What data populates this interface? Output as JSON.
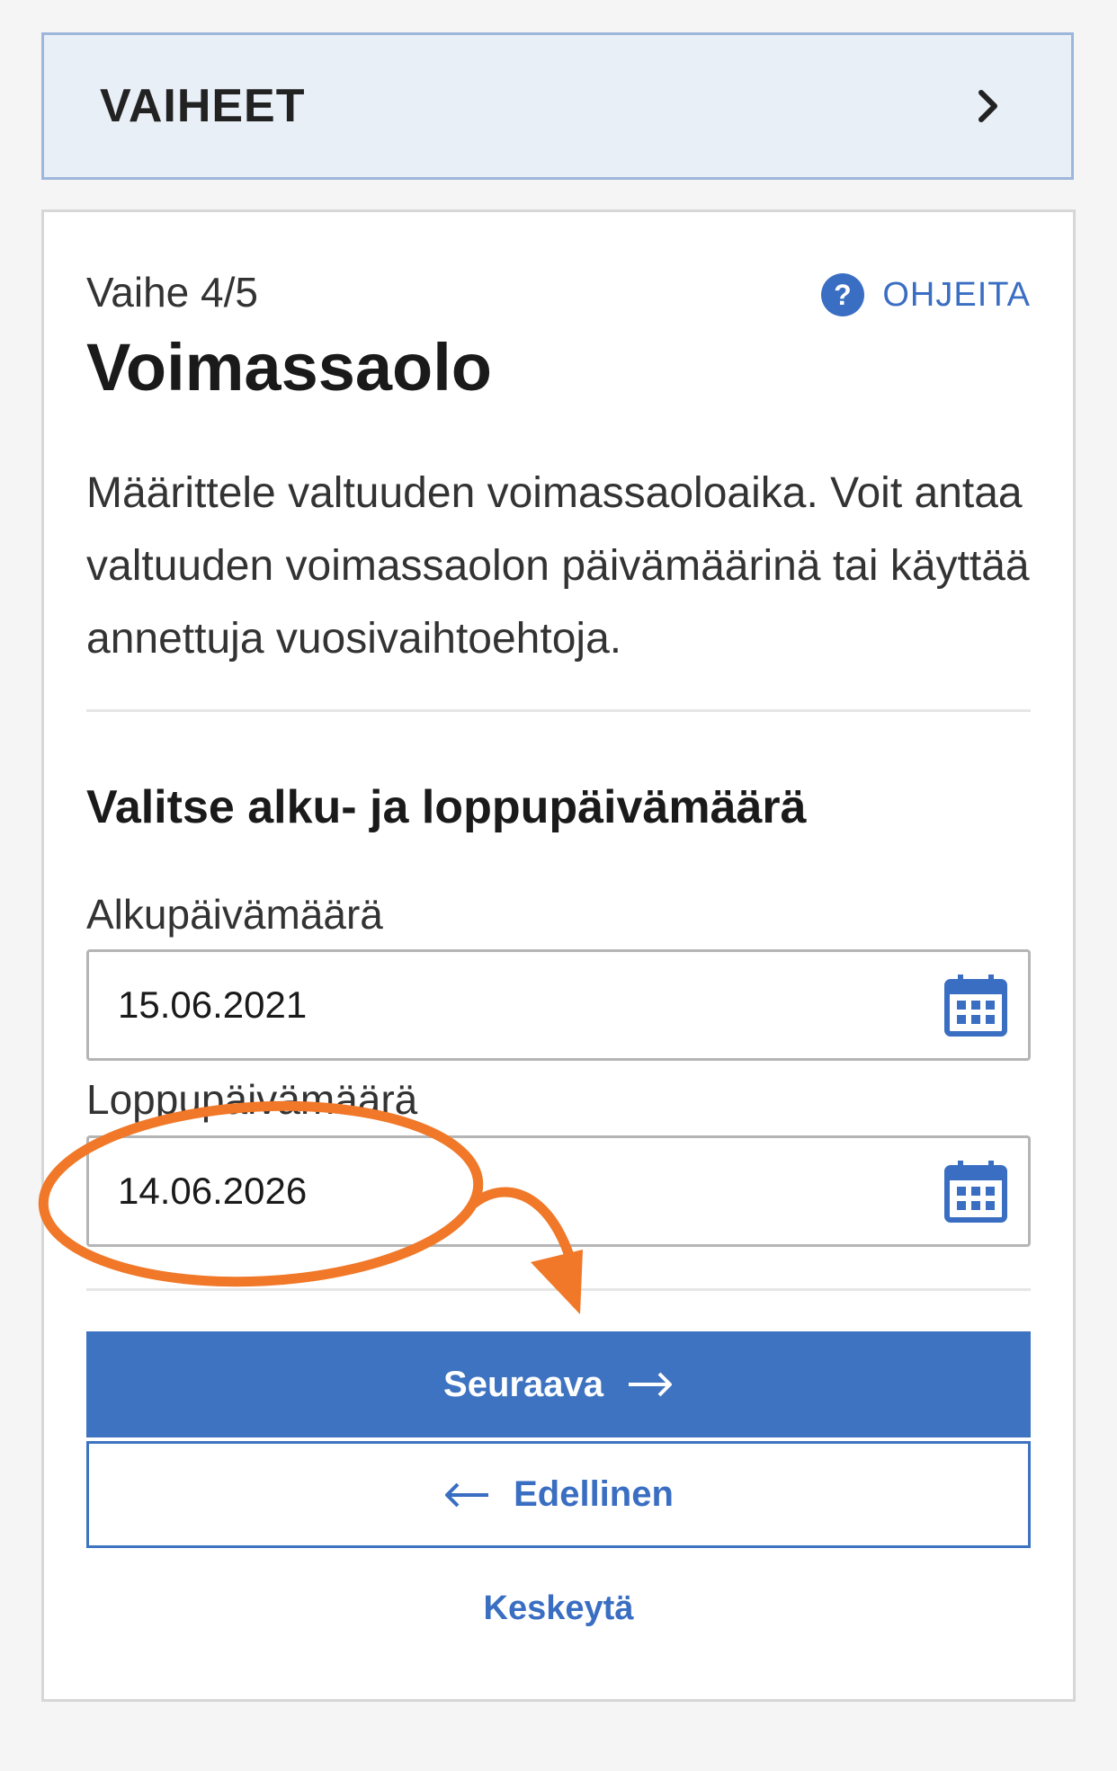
{
  "steps_bar": {
    "title": "VAIHEET",
    "icon": "chevron-right-icon"
  },
  "step": {
    "label": "Vaihe 4/5",
    "help": "OHJEITA",
    "title": "Voimassaolo",
    "description": "Määrittele valtuuden voimassaoloaika. Voit antaa valtuuden voimassaolon päivämäärinä tai käyttää annettuja vuosivaihtoehtoja."
  },
  "dates": {
    "section_title": "Valitse alku- ja loppupäivämäärä",
    "start_label": "Alkupäivämäärä",
    "start_value": "15.06.2021",
    "end_label": "Loppupäivämäärä",
    "end_value": "14.06.2026"
  },
  "actions": {
    "next": "Seuraava",
    "previous": "Edellinen",
    "cancel": "Keskeytä"
  },
  "colors": {
    "accent": "#3d73c0",
    "annotation": "#f07828",
    "steps_bg": "#e9eff7"
  }
}
